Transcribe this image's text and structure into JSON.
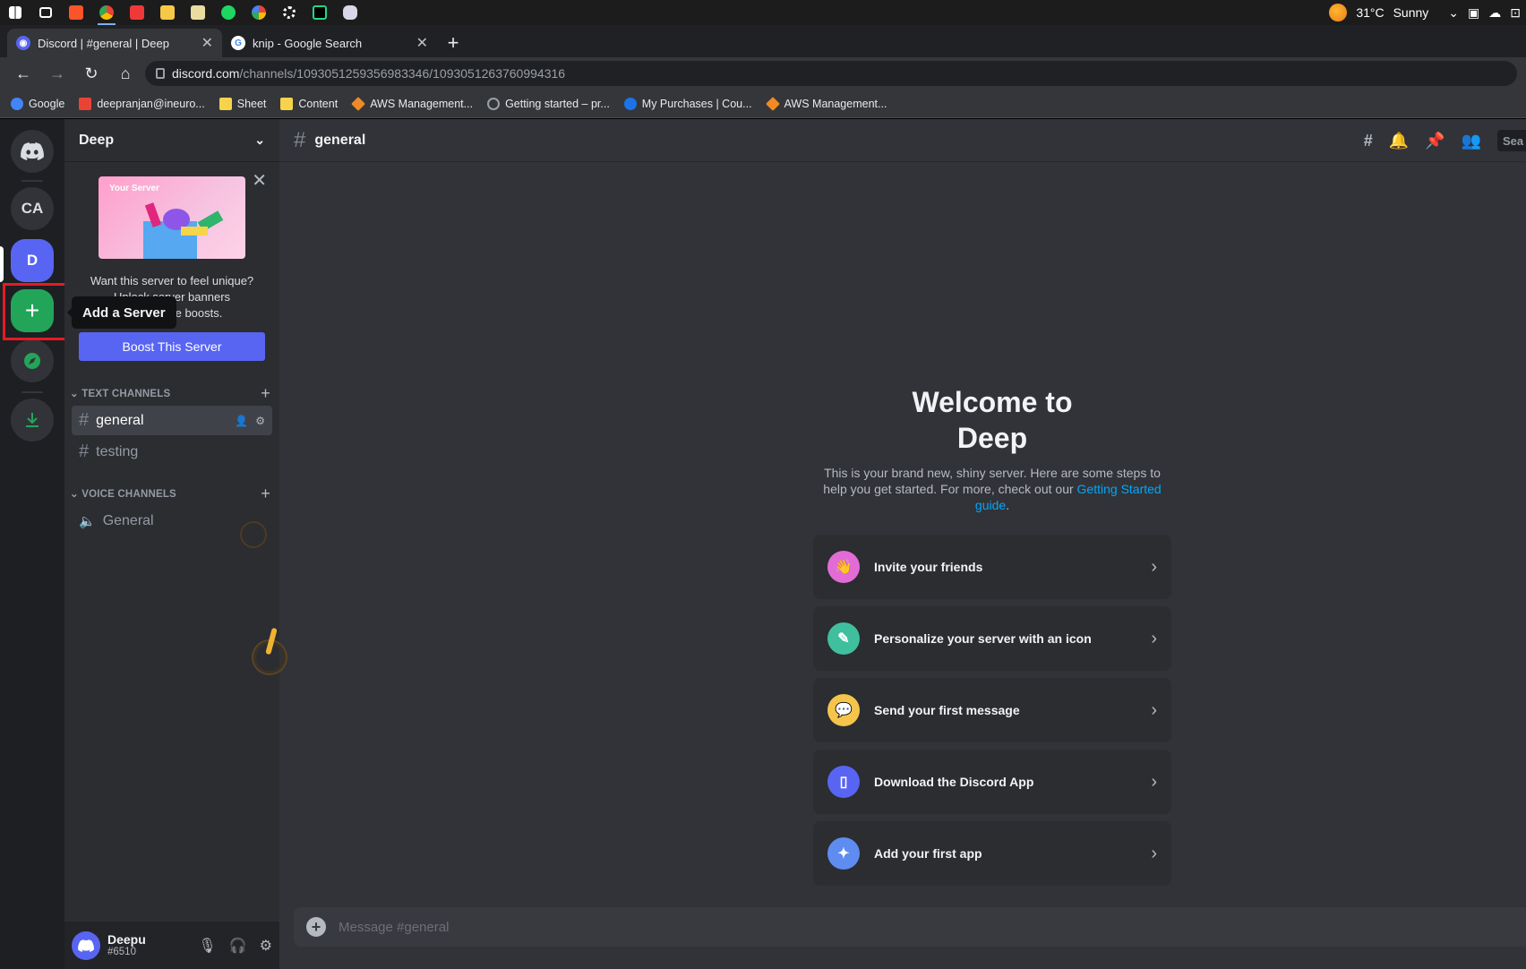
{
  "taskbar": {
    "weather_temp": "31°C",
    "weather_desc": "Sunny",
    "icons": [
      "windows-start-icon",
      "task-view-icon",
      "brave-icon",
      "chrome-icon",
      "vivaldi-icon",
      "file-explorer-icon",
      "notepad-icon",
      "spotify-icon",
      "app-icon",
      "settings-icon",
      "pycharm-icon",
      "app-icon-2"
    ]
  },
  "tabs": [
    {
      "title": "Discord | #general | Deep",
      "active": true
    },
    {
      "title": "knip - Google Search",
      "active": false
    }
  ],
  "address": {
    "host": "discord.com",
    "path": "/channels/1093051259356983346/1093051263760994316"
  },
  "bookmarks": [
    {
      "label": "Google",
      "color": "#4285f4"
    },
    {
      "label": "deepranjan@ineuro...",
      "color": "#ea4335"
    },
    {
      "label": "Sheet",
      "color": "#f6d34b"
    },
    {
      "label": "Content",
      "color": "#f6d34b"
    },
    {
      "label": "AWS Management...",
      "color": "#f08a24"
    },
    {
      "label": "Getting started – pr...",
      "color": "#9aa0a6"
    },
    {
      "label": "My Purchases | Cou...",
      "color": "#1a73e8"
    },
    {
      "label": "AWS Management...",
      "color": "#f08a24"
    }
  ],
  "guilds": {
    "ca_label": "CA",
    "d_label": "D",
    "add_symbol": "+",
    "tooltip": "Add a Server"
  },
  "server": {
    "name": "Deep",
    "promo_line1": "Want this server to feel unique?",
    "promo_line2": "Unlock server banners",
    "promo_line3": "with 7 more boosts.",
    "banner_label": "Your Server",
    "boost_button": "Boost This Server"
  },
  "categories": {
    "text": "TEXT CHANNELS",
    "voice": "VOICE CHANNELS"
  },
  "channels": {
    "text": [
      {
        "name": "general",
        "active": true
      },
      {
        "name": "testing",
        "active": false
      }
    ],
    "voice": [
      {
        "name": "General"
      }
    ]
  },
  "user": {
    "name": "Deepu",
    "tag": "#6510"
  },
  "chat": {
    "channel": "general",
    "search_placeholder": "Sea",
    "welcome_line1": "Welcome to",
    "welcome_line2": "Deep",
    "welcome_desc": "This is your brand new, shiny server. Here are some steps to help you get started. For more, check out our",
    "welcome_link": "Getting Started guide",
    "cards": [
      {
        "label": "Invite your friends",
        "color": "#e36bd6"
      },
      {
        "label": "Personalize your server with an icon",
        "color": "#3fbf9e"
      },
      {
        "label": "Send your first message",
        "color": "#f5c44b"
      },
      {
        "label": "Download the Discord App",
        "color": "#5865f2"
      },
      {
        "label": "Add your first app",
        "color": "#5f8cf0"
      }
    ],
    "composer_placeholder": "Message #general"
  }
}
